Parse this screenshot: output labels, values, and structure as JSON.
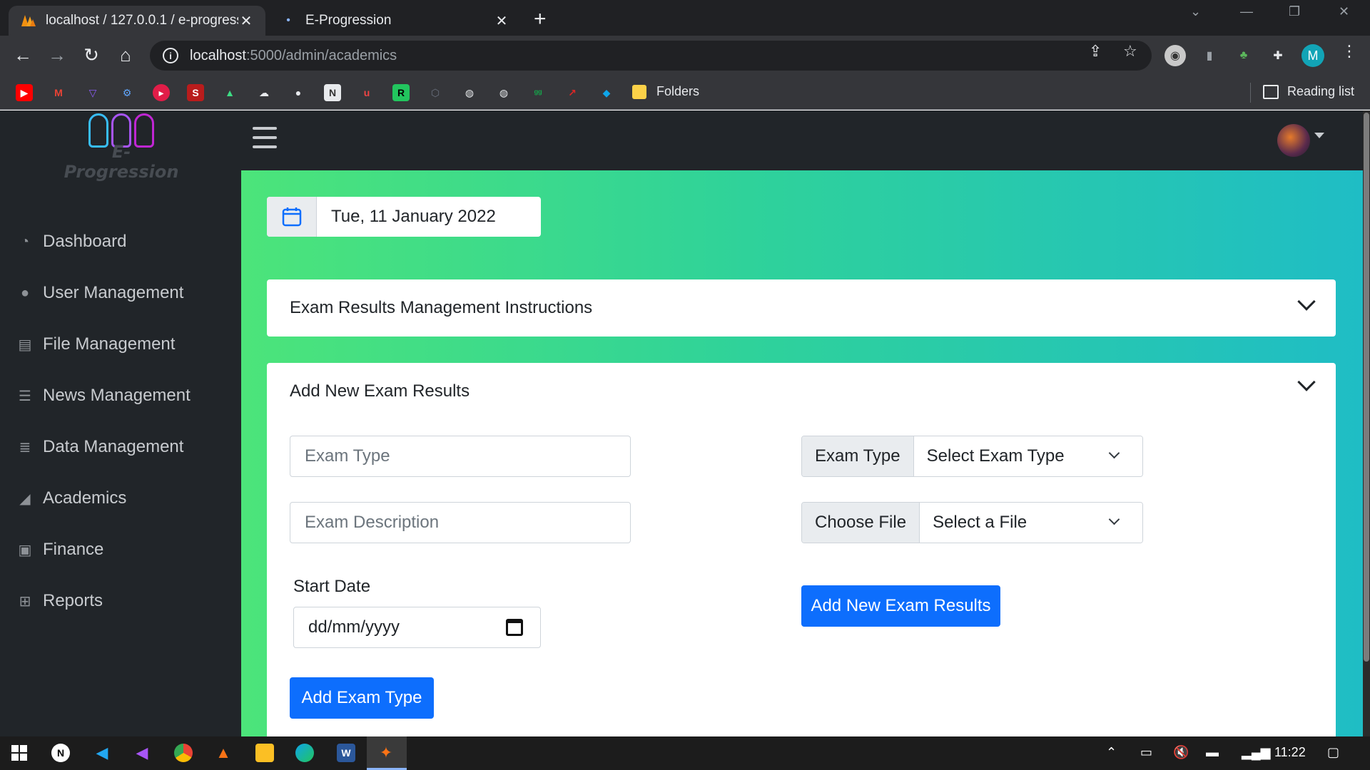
{
  "browser": {
    "tabs": [
      {
        "title": "localhost / 127.0.0.1 / e-progress",
        "favicon": "phpmyadmin-icon"
      },
      {
        "title": "E-Progression",
        "favicon": "page-icon"
      }
    ],
    "url_host": "localhost",
    "url_path": ":5000/admin/academics",
    "bookmarks_folder": "Folders",
    "reading_list": "Reading list",
    "profile_initial": "M"
  },
  "app": {
    "logo_text": "E-Progression",
    "sidebar": {
      "items": [
        {
          "label": "Dashboard",
          "icon": "dashboard-icon"
        },
        {
          "label": "User Management",
          "icon": "user-icon"
        },
        {
          "label": "File Management",
          "icon": "file-icon"
        },
        {
          "label": "News Management",
          "icon": "news-icon"
        },
        {
          "label": "Data Management",
          "icon": "database-icon"
        },
        {
          "label": "Academics",
          "icon": "chart-icon"
        },
        {
          "label": "Finance",
          "icon": "money-icon"
        },
        {
          "label": "Reports",
          "icon": "table-icon"
        }
      ]
    },
    "date_display": "Tue, 11 January 2022",
    "instructions_card": {
      "title": "Exam Results Management Instructions"
    },
    "add_card": {
      "title": "Add New Exam Results",
      "exam_type_placeholder": "Exam Type",
      "exam_description_placeholder": "Exam Description",
      "start_date_label": "Start Date",
      "start_date_placeholder": "dd/mm/yyyy",
      "add_exam_type_button": "Add Exam Type",
      "exam_type_select_label": "Exam Type",
      "exam_type_select_value": "Select Exam Type",
      "file_select_label": "Choose File",
      "file_select_value": "Select a File",
      "add_results_button": "Add New Exam Results"
    }
  },
  "taskbar": {
    "clock": "11:22"
  },
  "colors": {
    "primary": "#0d6efd",
    "sidebar_bg": "#212529",
    "gradient_start": "#4ce47a",
    "gradient_end": "#1fbdc5"
  }
}
